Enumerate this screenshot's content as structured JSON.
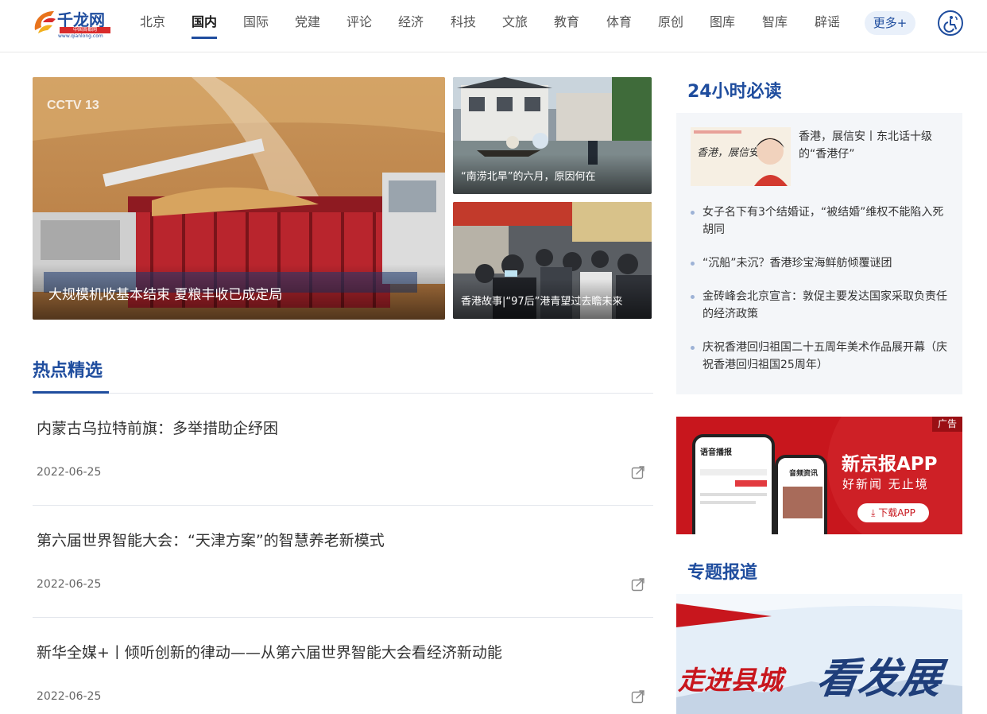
{
  "logo": {
    "name": "千龙网",
    "badge": "中国首都网",
    "url": "www.qianlong.com"
  },
  "nav": {
    "items": [
      {
        "label": "北京",
        "active": false
      },
      {
        "label": "国内",
        "active": true
      },
      {
        "label": "国际",
        "active": false
      },
      {
        "label": "党建",
        "active": false
      },
      {
        "label": "评论",
        "active": false
      },
      {
        "label": "经济",
        "active": false
      },
      {
        "label": "科技",
        "active": false
      },
      {
        "label": "文旅",
        "active": false
      },
      {
        "label": "教育",
        "active": false
      },
      {
        "label": "体育",
        "active": false
      },
      {
        "label": "原创",
        "active": false
      },
      {
        "label": "图库",
        "active": false
      },
      {
        "label": "智库",
        "active": false
      },
      {
        "label": "辟谣",
        "active": false
      }
    ],
    "more": "更多+"
  },
  "hero": {
    "main_caption": "大规模机收基本结束 夏粮丰收已成定局",
    "side": [
      {
        "caption": "“南涝北旱”的六月，原因何在"
      },
      {
        "caption": "香港故事|“97后”港青望过去瞻未来"
      }
    ]
  },
  "hot": {
    "title": "热点精选",
    "articles": [
      {
        "title": "内蒙古乌拉特前旗：多举措助企纾困",
        "date": "2022-06-25"
      },
      {
        "title": "第六届世界智能大会：“天津方案”的智慧养老新模式",
        "date": "2022-06-25"
      },
      {
        "title": "新华全媒+丨倾听创新的律动——从第六届世界智能大会看经济新动能",
        "date": "2022-06-25"
      }
    ]
  },
  "must_read": {
    "title": "24小时必读",
    "featured": {
      "title": "香港，展信安丨东北话十级的“香港仔”",
      "thumb_text": "香港，展信安。"
    },
    "items": [
      "女子名下有3个结婚证，“被结婚”维权不能陷入死胡同",
      "“沉船”未沉？香港珍宝海鲜舫倾覆谜团",
      "金砖峰会北京宣言：敦促主要发达国家采取负责任的经济政策",
      "庆祝香港回归祖国二十五周年美术作品展开幕（庆祝香港回归祖国25周年）"
    ]
  },
  "ad": {
    "badge": "广告",
    "title": "新京报APP",
    "subtitle": "好新闻 无止境",
    "button": "下载APP",
    "phone1": "语音播报",
    "phone2": "音频资讯"
  },
  "topics": {
    "title": "专题报道",
    "banner_text1": "走进县城",
    "banner_text2": "看发展"
  },
  "colors": {
    "brand": "#1f4d9e",
    "ad_red": "#c8161d"
  }
}
